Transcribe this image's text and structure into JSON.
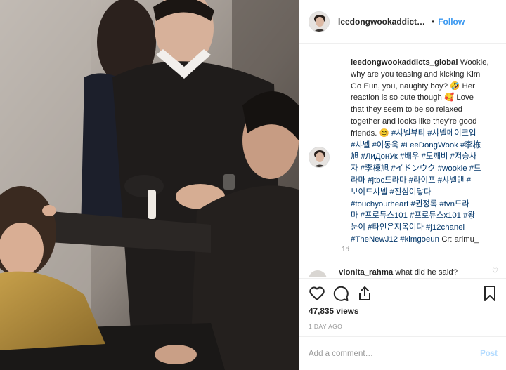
{
  "post_header": {
    "username": "leedongwookaddicts_global",
    "username_shown": "leedongwookaddicts_glob",
    "separator": "•",
    "follow_label": "Follow"
  },
  "caption": {
    "username": "leedongwookaddicts_global",
    "text_lines": [
      "Wookie,",
      "why are you teasing and kicking Kim",
      "Go Eun, you, naughty boy? 🤣 Her",
      "reaction is so cute though 🥰 Love",
      "that they seem to be so relaxed",
      "together and looks like they're good",
      "friends. 😊"
    ],
    "hashtags_lines": [
      "#샤넬뷰티 #샤넬메이크업",
      "#샤넬 #이동욱 #LeeDongWook #李栋",
      "旭 #ЛиДонУк #배우 #도깨비 #저승사",
      "자 #李棟旭 #イドンウク #wookie #드",
      "라마 #jtbc드라마 #라이프 #샤넬맨 #",
      "보이드샤넬 #진심이닿다",
      "#touchyourheart #권정록 #tvn드라",
      "마 #프로듀스101 #프로듀스x101 #왕",
      "눈이 #타인은지옥이다 #j12chanel",
      "#TheNewJ12 #kimgoeun"
    ],
    "credit": "Cr: arimu_",
    "time": "1d"
  },
  "next_comment": {
    "username": "vionita_rahma",
    "text": "what did he said?"
  },
  "actions": {
    "like": "heart-icon",
    "comment": "comment-icon",
    "share": "share-icon",
    "save": "bookmark-icon"
  },
  "stats": {
    "views": "47,835 views",
    "date": "1 DAY AGO"
  },
  "add_comment": {
    "placeholder": "Add a comment…",
    "post_label": "Post"
  },
  "colors": {
    "link": "#3897f0",
    "hashtag": "#003569",
    "muted": "#999999",
    "post_disabled": "#b3dbff"
  }
}
